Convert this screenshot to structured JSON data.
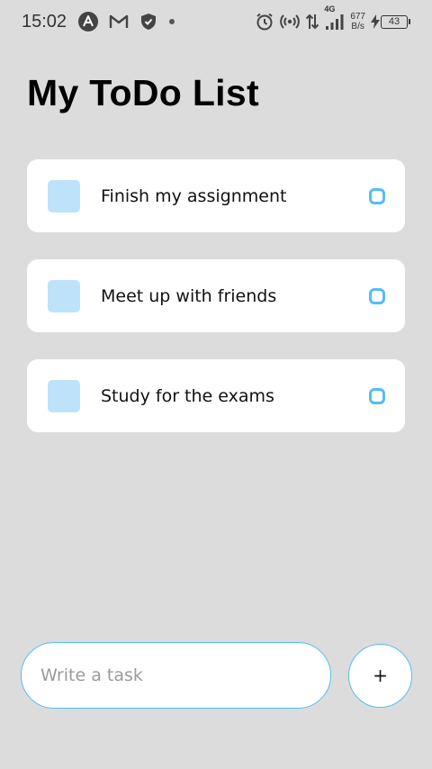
{
  "status_bar": {
    "time": "15:02",
    "left_icons": [
      "app-a-icon",
      "gmail-icon",
      "shield-icon",
      "dot-icon"
    ],
    "right_icons": [
      "alarm-icon",
      "hotspot-icon",
      "data-arrows-icon",
      "signal-4g-icon",
      "charging-icon"
    ],
    "network_type": "4G",
    "net_speed_value": "677",
    "net_speed_unit": "B/s",
    "battery_level": "43"
  },
  "header": {
    "title": "My ToDo List"
  },
  "tasks": [
    {
      "text": "Finish my assignment"
    },
    {
      "text": "Meet up with friends"
    },
    {
      "text": "Study for the exams"
    }
  ],
  "composer": {
    "input_placeholder": "Write a task",
    "input_value": "",
    "add_label": "+"
  },
  "colors": {
    "background": "#dcdcdc",
    "card": "#ffffff",
    "task_square": "#bde3fb",
    "accent": "#55bcf6"
  }
}
